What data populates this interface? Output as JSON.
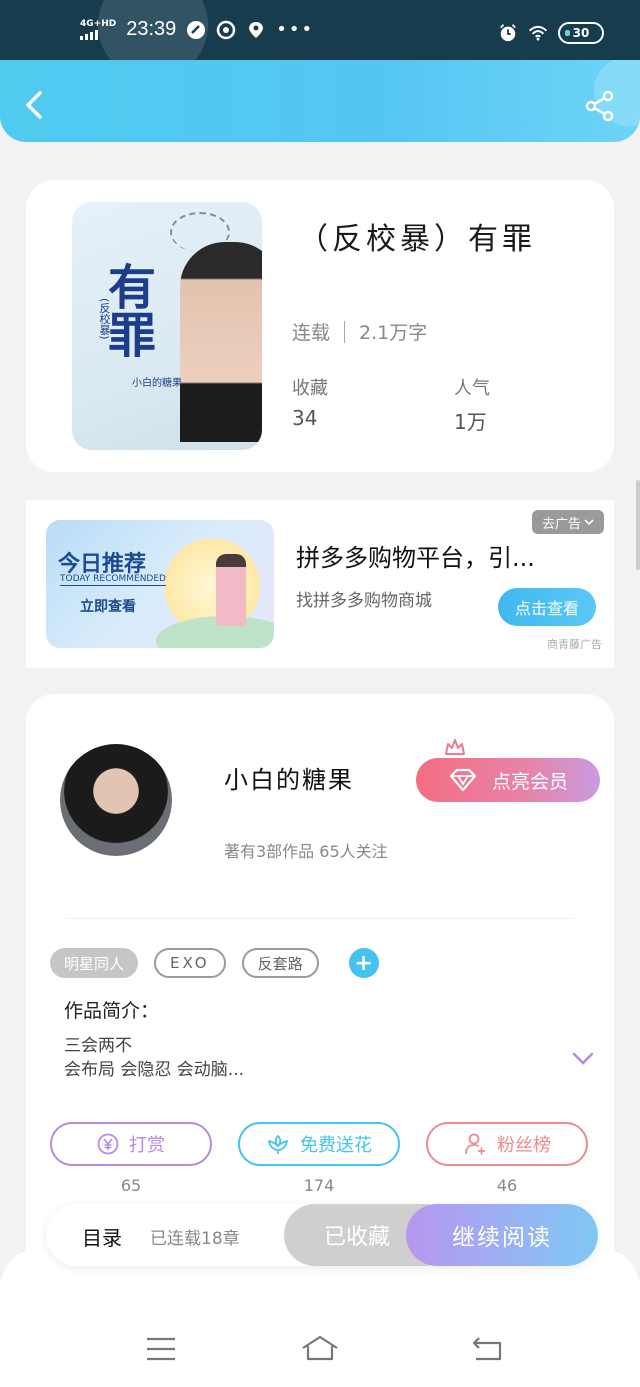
{
  "status_bar": {
    "network": "4G+HD",
    "time": "23:39",
    "battery": "30"
  },
  "header": {
    "back_icon": "chevron-left-icon",
    "share_icon": "share-icon"
  },
  "book": {
    "title": "（反校暴）有罪",
    "status": "连载",
    "word_count": "2.1万字",
    "favorites_label": "收藏",
    "favorites_value": "34",
    "popularity_label": "人气",
    "popularity_value": "1万",
    "cover": {
      "title": "有罪",
      "subtitle": "(反校暴)",
      "author": "小白的糖果"
    }
  },
  "ad": {
    "image_title": "今日推荐",
    "image_subtitle": "TODAY RECOMMENDED",
    "image_cta": "立即查看",
    "title": "拼多多购物平台，引...",
    "subtitle": "找拼多多购物商城",
    "close_label": "去广告",
    "button_label": "点击查看",
    "source": "商青藤广告"
  },
  "author": {
    "name": "小白的糖果",
    "works": "著有3部作品 65人关注",
    "vip_label": "点亮会员"
  },
  "tags": [
    "明星同人",
    "EXO",
    "反套路"
  ],
  "intro": {
    "heading": "作品简介：",
    "text": "三会两不\n会布局 会隐忍 会动脑..."
  },
  "actions": [
    {
      "label": "打赏",
      "count": "65",
      "icon": "yen-icon",
      "color": "#b48be0"
    },
    {
      "label": "免费送花",
      "count": "174",
      "icon": "flower-icon",
      "color": "#45c2ef"
    },
    {
      "label": "粉丝榜",
      "count": "46",
      "icon": "fan-icon",
      "color": "#ee8a8a"
    }
  ],
  "bottom_bar": {
    "toc_label": "目录",
    "toc_status": "已连载18章",
    "favorited_label": "已收藏",
    "read_label": "继续阅读"
  },
  "nav": {
    "menu_icon": "menu-icon",
    "home_icon": "home-icon",
    "back_icon": "return-icon"
  }
}
